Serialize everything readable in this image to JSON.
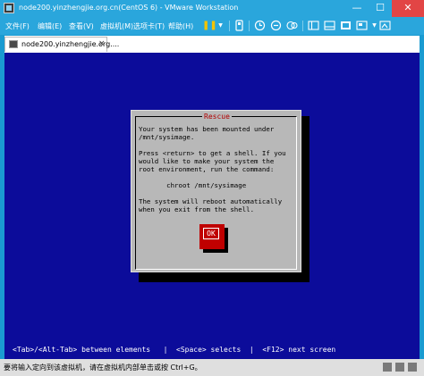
{
  "window": {
    "title": "node200.yinzhengjie.org.cn(CentOS 6) - VMware Workstation",
    "minimize_glyph": "—",
    "maximize_glyph": "☐",
    "close_glyph": "✕"
  },
  "menu": {
    "items": [
      "文件(F)",
      "编辑(E)",
      "查看(V)",
      "虚拟机(M)",
      "选项卡(T)",
      "帮助(H)"
    ]
  },
  "tab": {
    "label": "node200.yinzhengjie.org....",
    "close_glyph": "×"
  },
  "dialog": {
    "title": "Rescue",
    "body": "Your system has been mounted under\n/mnt/sysimage.\n\nPress <return> to get a shell. If you\nwould like to make your system the\nroot environment, run the command:\n\n       chroot /mnt/sysimage\n\nThe system will reboot automatically\nwhen you exit from the shell.",
    "ok_label": "OK"
  },
  "console": {
    "status_line": "<Tab>/<Alt-Tab> between elements   |  <Space> selects  |  <F12> next screen"
  },
  "statusbar": {
    "text": "要将输入定向到该虚拟机，请在虚拟机内部单击或按 Ctrl+G。"
  },
  "colors": {
    "chrome": "#2aa6dc",
    "console_bg": "#0c0c9a",
    "dialog_bg": "#b8b8b8",
    "dialog_title": "#b00000",
    "ok_button": "#c00000"
  }
}
